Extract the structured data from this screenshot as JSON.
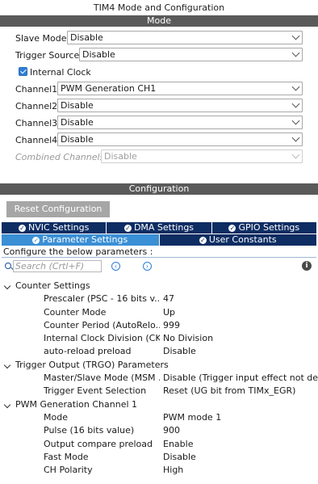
{
  "window_title": "TIM4 Mode and Configuration",
  "mode_section": {
    "header": "Mode",
    "fields": [
      {
        "label": "Slave Mode",
        "value": "Disable",
        "enabled": true
      },
      {
        "label": "Trigger Source",
        "value": "Disable",
        "enabled": true
      }
    ],
    "internal_clock": {
      "label": "Internal Clock",
      "checked": true
    },
    "channels": [
      {
        "label": "Channel1",
        "value": "PWM Generation CH1",
        "enabled": true
      },
      {
        "label": "Channel2",
        "value": "Disable",
        "enabled": true
      },
      {
        "label": "Channel3",
        "value": "Disable",
        "enabled": true
      },
      {
        "label": "Channel4",
        "value": "Disable",
        "enabled": true
      },
      {
        "label": "Combined Channels",
        "value": "Disable",
        "enabled": false
      }
    ]
  },
  "config_section": {
    "header": "Configuration",
    "reset_button": "Reset Configuration",
    "tabs_row1": [
      "NVIC Settings",
      "DMA Settings",
      "GPIO Settings"
    ],
    "tabs_row2": [
      "Parameter Settings",
      "User Constants"
    ],
    "active_tab": "Parameter Settings",
    "configure_text": "Configure the below parameters :",
    "search_placeholder": "Search (Crtl+F)",
    "groups": [
      {
        "label": "Counter Settings",
        "params": [
          {
            "name": "Prescaler (PSC - 16 bits v...",
            "value": "47"
          },
          {
            "name": "Counter Mode",
            "value": "Up"
          },
          {
            "name": "Counter Period (AutoRelo...",
            "value": "999"
          },
          {
            "name": "Internal Clock Division (CK...",
            "value": "No Division"
          },
          {
            "name": "auto-reload preload",
            "value": "Disable"
          }
        ]
      },
      {
        "label": "Trigger Output (TRGO) Parameters",
        "params": [
          {
            "name": "Master/Slave Mode (MSM ...",
            "value": "Disable (Trigger input effect not del..."
          },
          {
            "name": "Trigger Event Selection",
            "value": "Reset (UG bit from TIMx_EGR)"
          }
        ]
      },
      {
        "label": "PWM Generation Channel 1",
        "params": [
          {
            "name": "Mode",
            "value": "PWM mode 1"
          },
          {
            "name": "Pulse (16 bits value)",
            "value": "900"
          },
          {
            "name": "Output compare preload",
            "value": "Enable"
          },
          {
            "name": "Fast Mode",
            "value": "Disable"
          },
          {
            "name": "CH Polarity",
            "value": "High"
          }
        ]
      }
    ]
  }
}
